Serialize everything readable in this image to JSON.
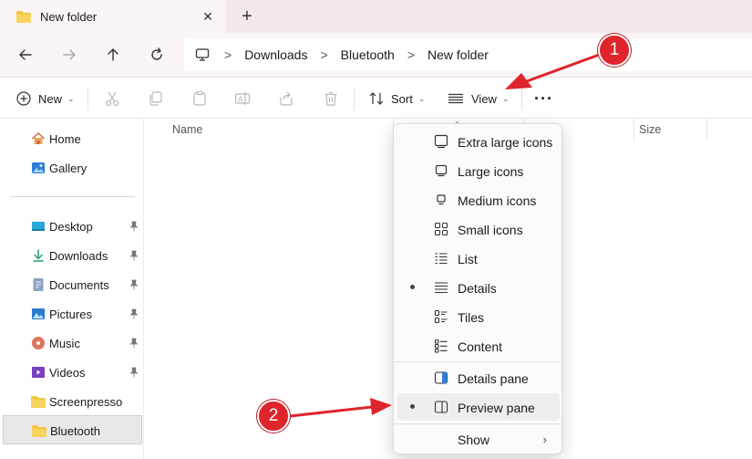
{
  "tab": {
    "title": "New folder",
    "close": "✕",
    "new_tab": "+"
  },
  "breadcrumb": [
    "Downloads",
    "Bluetooth",
    "New folder"
  ],
  "breadcrumb_sep": ">",
  "toolbar": {
    "new_label": "New",
    "sort_label": "Sort",
    "view_label": "View",
    "more_label": "···"
  },
  "sidebar": {
    "items": [
      {
        "label": "Home",
        "icon": "home-icon"
      },
      {
        "label": "Gallery",
        "icon": "gallery-icon"
      },
      {
        "label": "Desktop",
        "icon": "desktop-icon",
        "pinned": true
      },
      {
        "label": "Downloads",
        "icon": "download-icon",
        "pinned": true
      },
      {
        "label": "Documents",
        "icon": "documents-icon",
        "pinned": true
      },
      {
        "label": "Pictures",
        "icon": "pictures-icon",
        "pinned": true
      },
      {
        "label": "Music",
        "icon": "music-icon",
        "pinned": true
      },
      {
        "label": "Videos",
        "icon": "videos-icon",
        "pinned": true
      },
      {
        "label": "Screenpresso",
        "icon": "folder-icon"
      },
      {
        "label": "Bluetooth",
        "icon": "folder-icon",
        "selected": true
      }
    ]
  },
  "columns": {
    "name": "Name",
    "size": "Size"
  },
  "view_menu": {
    "items": [
      {
        "label": "Extra large icons"
      },
      {
        "label": "Large icons"
      },
      {
        "label": "Medium icons"
      },
      {
        "label": "Small icons"
      },
      {
        "label": "List"
      },
      {
        "label": "Details",
        "selected": true
      },
      {
        "label": "Tiles"
      },
      {
        "label": "Content"
      },
      {
        "label": "Details pane"
      },
      {
        "label": "Preview pane",
        "selected": true,
        "hover": true
      },
      {
        "label": "Show"
      }
    ]
  },
  "annotations": {
    "step1": "1",
    "step2": "2"
  },
  "colors": {
    "accent_red": "#e0242b",
    "folder_yellow": "#f4c542",
    "tab_bg": "#f3e9ec"
  }
}
